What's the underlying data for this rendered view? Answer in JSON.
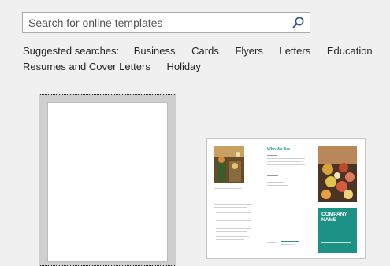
{
  "search": {
    "placeholder": "Search for online templates",
    "value": "",
    "button_icon": "search-icon"
  },
  "suggested": {
    "label": "Suggested searches:",
    "links": [
      "Business",
      "Cards",
      "Flyers",
      "Letters",
      "Education",
      "Resumes and Cover Letters",
      "Holiday"
    ]
  },
  "brochure": {
    "heading": "Who We Are",
    "company_name": [
      "COMPANY",
      "NAME"
    ]
  },
  "colors": {
    "accent": "#1c9184",
    "background": "#f0f0f0",
    "search_icon": "#2b579a"
  }
}
